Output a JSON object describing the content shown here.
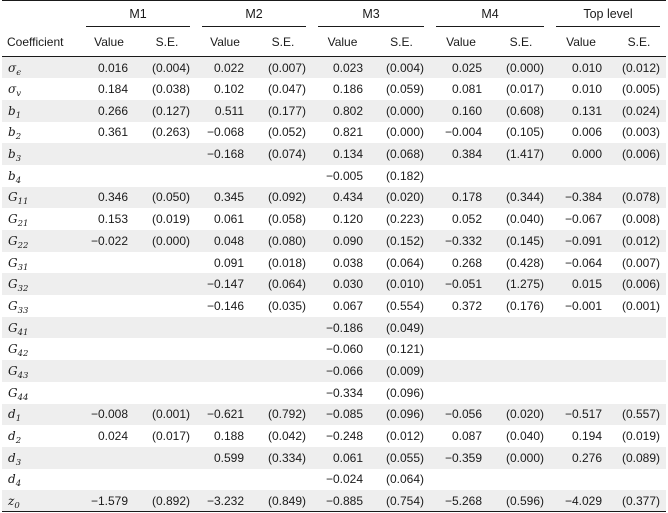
{
  "table": {
    "coef_header": "Coefficient",
    "groups": [
      "M1",
      "M2",
      "M3",
      "M4",
      "Top level"
    ],
    "sub_headers": {
      "value": "Value",
      "se": "S.E."
    },
    "rows": [
      {
        "sym": "σ",
        "sub": "ϵ",
        "cells": [
          "0.016",
          "(0.004)",
          "0.022",
          "(0.007)",
          "0.023",
          "(0.004)",
          "0.025",
          "(0.000)",
          "0.010",
          "(0.012)"
        ]
      },
      {
        "sym": "σ",
        "sub": "v",
        "cells": [
          "0.184",
          "(0.038)",
          "0.102",
          "(0.047)",
          "0.186",
          "(0.059)",
          "0.081",
          "(0.017)",
          "0.010",
          "(0.005)"
        ]
      },
      {
        "sym": "b",
        "sub": "1",
        "cells": [
          "0.266",
          "(0.127)",
          "0.511",
          "(0.177)",
          "0.802",
          "(0.000)",
          "0.160",
          "(0.608)",
          "0.131",
          "(0.024)"
        ]
      },
      {
        "sym": "b",
        "sub": "2",
        "cells": [
          "0.361",
          "(0.263)",
          "−0.068",
          "(0.052)",
          "0.821",
          "(0.000)",
          "−0.004",
          "(0.105)",
          "0.006",
          "(0.003)"
        ]
      },
      {
        "sym": "b",
        "sub": "3",
        "cells": [
          "",
          "",
          "−0.168",
          "(0.074)",
          "0.134",
          "(0.068)",
          "0.384",
          "(1.417)",
          "0.000",
          "(0.006)"
        ]
      },
      {
        "sym": "b",
        "sub": "4",
        "cells": [
          "",
          "",
          "",
          "",
          "−0.005",
          "(0.182)",
          "",
          "",
          "",
          ""
        ]
      },
      {
        "sym": "G",
        "sub": "11",
        "cells": [
          "0.346",
          "(0.050)",
          "0.345",
          "(0.092)",
          "0.434",
          "(0.020)",
          "0.178",
          "(0.344)",
          "−0.384",
          "(0.078)"
        ]
      },
      {
        "sym": "G",
        "sub": "21",
        "cells": [
          "0.153",
          "(0.019)",
          "0.061",
          "(0.058)",
          "0.120",
          "(0.223)",
          "0.052",
          "(0.040)",
          "−0.067",
          "(0.008)"
        ]
      },
      {
        "sym": "G",
        "sub": "22",
        "cells": [
          "−0.022",
          "(0.000)",
          "0.048",
          "(0.080)",
          "0.090",
          "(0.152)",
          "−0.332",
          "(0.145)",
          "−0.091",
          "(0.012)"
        ]
      },
      {
        "sym": "G",
        "sub": "31",
        "cells": [
          "",
          "",
          "0.091",
          "(0.018)",
          "0.038",
          "(0.064)",
          "0.268",
          "(0.428)",
          "−0.064",
          "(0.007)"
        ]
      },
      {
        "sym": "G",
        "sub": "32",
        "cells": [
          "",
          "",
          "−0.147",
          "(0.064)",
          "0.030",
          "(0.010)",
          "−0.051",
          "(1.275)",
          "0.015",
          "(0.006)"
        ]
      },
      {
        "sym": "G",
        "sub": "33",
        "cells": [
          "",
          "",
          "−0.146",
          "(0.035)",
          "0.067",
          "(0.554)",
          "0.372",
          "(0.176)",
          "−0.001",
          "(0.001)"
        ]
      },
      {
        "sym": "G",
        "sub": "41",
        "cells": [
          "",
          "",
          "",
          "",
          "−0.186",
          "(0.049)",
          "",
          "",
          "",
          ""
        ]
      },
      {
        "sym": "G",
        "sub": "42",
        "cells": [
          "",
          "",
          "",
          "",
          "−0.060",
          "(0.121)",
          "",
          "",
          "",
          ""
        ]
      },
      {
        "sym": "G",
        "sub": "43",
        "cells": [
          "",
          "",
          "",
          "",
          "−0.066",
          "(0.009)",
          "",
          "",
          "",
          ""
        ]
      },
      {
        "sym": "G",
        "sub": "44",
        "cells": [
          "",
          "",
          "",
          "",
          "−0.334",
          "(0.096)",
          "",
          "",
          "",
          ""
        ]
      },
      {
        "sym": "d",
        "sub": "1",
        "cells": [
          "−0.008",
          "(0.001)",
          "−0.621",
          "(0.792)",
          "−0.085",
          "(0.096)",
          "−0.056",
          "(0.020)",
          "−0.517",
          "(0.557)"
        ]
      },
      {
        "sym": "d",
        "sub": "2",
        "cells": [
          "0.024",
          "(0.017)",
          "0.188",
          "(0.042)",
          "−0.248",
          "(0.012)",
          "0.087",
          "(0.040)",
          "0.194",
          "(0.019)"
        ]
      },
      {
        "sym": "d",
        "sub": "3",
        "cells": [
          "",
          "",
          "0.599",
          "(0.334)",
          "0.061",
          "(0.055)",
          "−0.359",
          "(0.000)",
          "0.276",
          "(0.089)"
        ]
      },
      {
        "sym": "d",
        "sub": "4",
        "cells": [
          "",
          "",
          "",
          "",
          "−0.024",
          "(0.064)",
          "",
          "",
          "",
          ""
        ]
      },
      {
        "sym": "z",
        "sub": "0",
        "cells": [
          "−1.579",
          "(0.892)",
          "−3.232",
          "(0.849)",
          "−0.885",
          "(0.754)",
          "−5.268",
          "(0.596)",
          "−4.029",
          "(0.377)"
        ]
      }
    ]
  }
}
